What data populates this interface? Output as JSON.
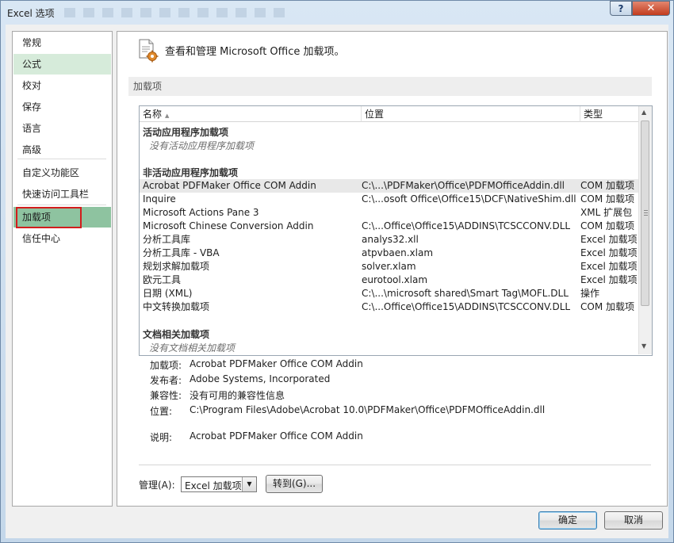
{
  "window": {
    "title": "Excel 选项",
    "help_label": "?",
    "close_label": "✕"
  },
  "sidebar": {
    "items": [
      {
        "label": "常规"
      },
      {
        "label": "公式"
      },
      {
        "label": "校对"
      },
      {
        "label": "保存"
      },
      {
        "label": "语言"
      },
      {
        "label": "高级"
      },
      {
        "label": "自定义功能区"
      },
      {
        "label": "快速访问工具栏"
      },
      {
        "label": "加载项"
      },
      {
        "label": "信任中心"
      }
    ],
    "selected": "加载项",
    "hovered": "公式"
  },
  "header": {
    "title": "查看和管理 Microsoft Office 加载项。",
    "icon": "addins-gear-icon"
  },
  "section": {
    "label": "加载项"
  },
  "table": {
    "columns": [
      "名称",
      "位置",
      "类型"
    ],
    "sort_indicator": "▲",
    "groups": {
      "active": {
        "label": "活动应用程序加载项",
        "empty": "没有活动应用程序加载项"
      },
      "inactive": {
        "label": "非活动应用程序加载项"
      },
      "document": {
        "label": "文档相关加载项",
        "empty": "没有文档相关加载项"
      }
    },
    "rows": [
      {
        "name": "Acrobat PDFMaker Office COM Addin",
        "location": "C:\\...\\PDFMaker\\Office\\PDFMOfficeAddin.dll",
        "type": "COM 加载项"
      },
      {
        "name": "Inquire",
        "location": "C:\\...osoft Office\\Office15\\DCF\\NativeShim.dll",
        "type": "COM 加载项"
      },
      {
        "name": "Microsoft Actions Pane 3",
        "location": "",
        "type": "XML 扩展包"
      },
      {
        "name": "Microsoft Chinese Conversion Addin",
        "location": "C:\\...Office\\Office15\\ADDINS\\TCSCCONV.DLL",
        "type": "COM 加载项"
      },
      {
        "name": "分析工具库",
        "location": "analys32.xll",
        "type": "Excel 加载项"
      },
      {
        "name": "分析工具库 - VBA",
        "location": "atpvbaen.xlam",
        "type": "Excel 加载项"
      },
      {
        "name": "规划求解加载项",
        "location": "solver.xlam",
        "type": "Excel 加载项"
      },
      {
        "name": "欧元工具",
        "location": "eurotool.xlam",
        "type": "Excel 加载项"
      },
      {
        "name": "日期 (XML)",
        "location": "C:\\...\\microsoft shared\\Smart Tag\\MOFL.DLL",
        "type": "操作"
      },
      {
        "name": "中文转换加载项",
        "location": "C:\\...Office\\Office15\\ADDINS\\TCSCCONV.DLL",
        "type": "COM 加载项"
      }
    ],
    "selected_row": 0
  },
  "details": {
    "addin_label": "加载项:",
    "addin_value": "Acrobat PDFMaker Office COM Addin",
    "publisher_label": "发布者:",
    "publisher_value": "Adobe Systems, Incorporated",
    "compat_label": "兼容性:",
    "compat_value": "没有可用的兼容性信息",
    "location_label": "位置:",
    "location_value": "C:\\Program Files\\Adobe\\Acrobat 10.0\\PDFMaker\\Office\\PDFMOfficeAddin.dll",
    "desc_label": "说明:",
    "desc_value": "Acrobat PDFMaker Office COM Addin"
  },
  "footer": {
    "manage_label": "管理(A):",
    "manage_selected": "Excel 加载项",
    "go_label": "转到(G)...",
    "ok_label": "确定",
    "cancel_label": "取消"
  },
  "colors": {
    "selected_nav": "#8ec3a0",
    "hover_nav": "#d6ebda",
    "highlight_box": "#d21d1d"
  }
}
